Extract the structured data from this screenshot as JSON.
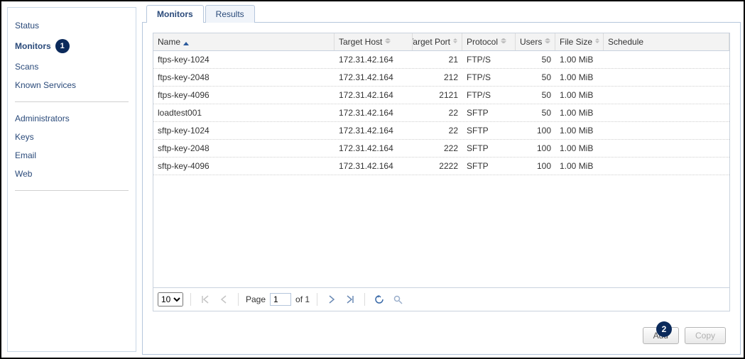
{
  "sidebar": {
    "group_a": [
      {
        "label": "Status"
      },
      {
        "label": "Monitors",
        "active": true,
        "badge": "1"
      },
      {
        "label": "Scans"
      },
      {
        "label": "Known Services"
      }
    ],
    "group_b": [
      {
        "label": "Administrators"
      },
      {
        "label": "Keys"
      },
      {
        "label": "Email"
      },
      {
        "label": "Web"
      }
    ]
  },
  "tabs": [
    {
      "label": "Monitors",
      "active": true
    },
    {
      "label": "Results"
    }
  ],
  "columns": {
    "name": "Name",
    "host": "Target Host",
    "port": "Target Port",
    "protocol": "Protocol",
    "users": "Users",
    "size": "File Size",
    "schedule": "Schedule"
  },
  "rows": [
    {
      "name": "ftps-key-1024",
      "host": "172.31.42.164",
      "port": "21",
      "protocol": "FTP/S",
      "users": "50",
      "size": "1.00 MiB",
      "schedule": ""
    },
    {
      "name": "ftps-key-2048",
      "host": "172.31.42.164",
      "port": "212",
      "protocol": "FTP/S",
      "users": "50",
      "size": "1.00 MiB",
      "schedule": ""
    },
    {
      "name": "ftps-key-4096",
      "host": "172.31.42.164",
      "port": "2121",
      "protocol": "FTP/S",
      "users": "50",
      "size": "1.00 MiB",
      "schedule": ""
    },
    {
      "name": "loadtest001",
      "host": "172.31.42.164",
      "port": "22",
      "protocol": "SFTP",
      "users": "50",
      "size": "1.00 MiB",
      "schedule": ""
    },
    {
      "name": "sftp-key-1024",
      "host": "172.31.42.164",
      "port": "22",
      "protocol": "SFTP",
      "users": "100",
      "size": "1.00 MiB",
      "schedule": ""
    },
    {
      "name": "sftp-key-2048",
      "host": "172.31.42.164",
      "port": "222",
      "protocol": "SFTP",
      "users": "100",
      "size": "1.00 MiB",
      "schedule": ""
    },
    {
      "name": "sftp-key-4096",
      "host": "172.31.42.164",
      "port": "2222",
      "protocol": "SFTP",
      "users": "100",
      "size": "1.00 MiB",
      "schedule": ""
    }
  ],
  "pager": {
    "page_size": "10",
    "page_label": "Page",
    "page_value": "1",
    "of_label": "of 1"
  },
  "footer": {
    "badge": "2",
    "add": "Add",
    "copy": "Copy"
  }
}
